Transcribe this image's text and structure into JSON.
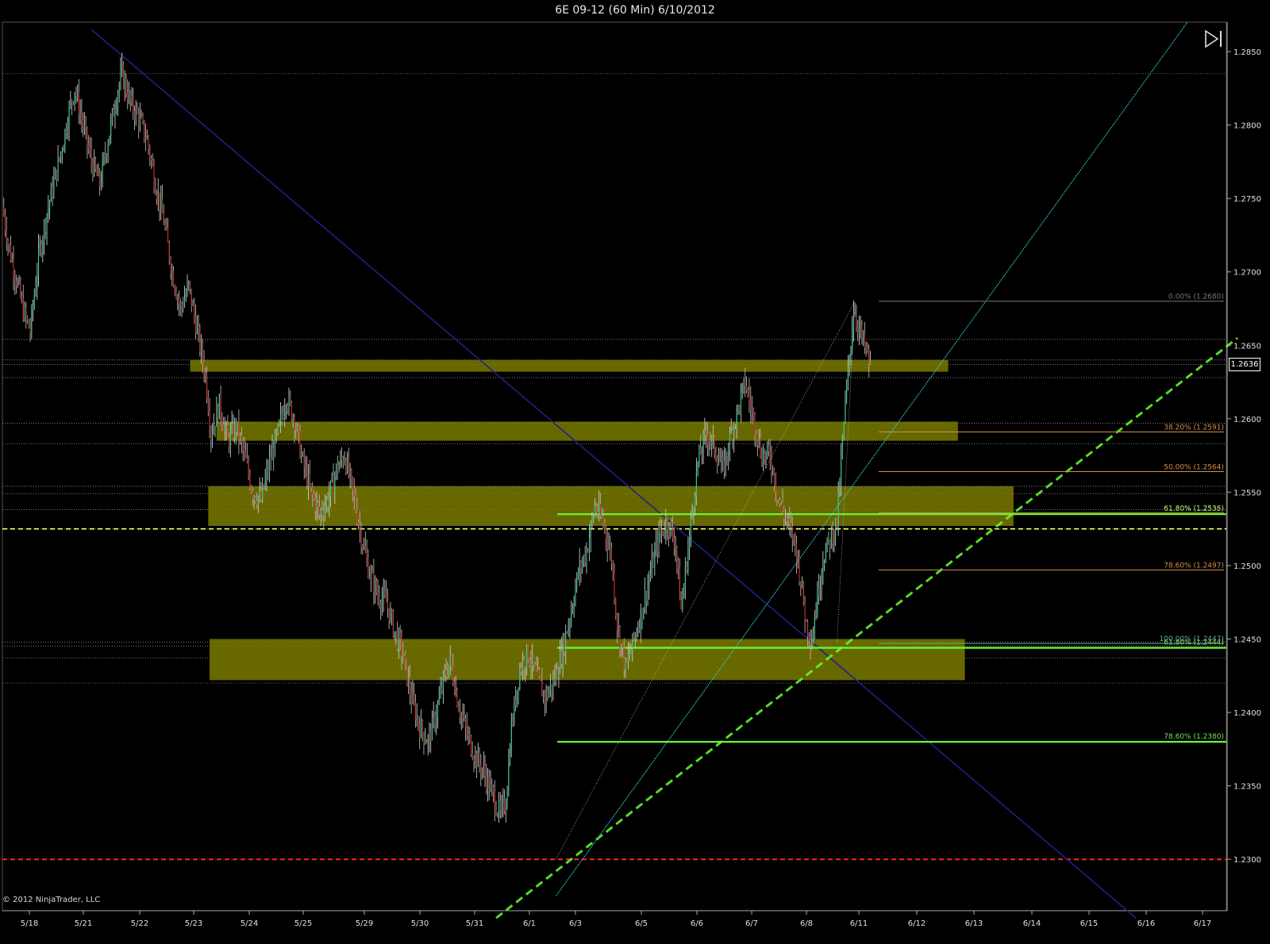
{
  "window": {
    "title": "6E 09-12 (60 Min)  6/10/2012"
  },
  "footer": {
    "copyright": "© 2012 NinjaTrader, LLC"
  },
  "last_price": "1.2636",
  "icons": {
    "scroll_end": "skip-to-end-icon"
  },
  "colors": {
    "background": "#000000",
    "zone": "#7f7f00",
    "fib_orange": "#d09048",
    "fib_green": "#66ff33",
    "support_red": "#ff2020",
    "dashed_yellow": "#ffff66",
    "trend_blue": "#202088",
    "trend_cyan": "#33cccc",
    "up_bar": "#33cc99",
    "down_bar": "#cc3333"
  },
  "chart_data": {
    "type": "candlestick",
    "instrument": "6E 09-12",
    "interval": "60 Min",
    "date": "6/10/2012",
    "y_axis": {
      "range": [
        1.2265,
        1.287
      ],
      "ticks": [
        "1.2850",
        "1.2800",
        "1.2750",
        "1.2700",
        "1.2650",
        "1.2600",
        "1.2550",
        "1.2500",
        "1.2450",
        "1.2400",
        "1.2350",
        "1.2300"
      ]
    },
    "x_axis": {
      "labels": [
        "5/18",
        "5/21",
        "5/22",
        "5/23",
        "5/24",
        "5/25",
        "5/29",
        "5/30",
        "5/31",
        "6/1",
        "6/3",
        "6/5",
        "6/6",
        "6/7",
        "6/8",
        "6/11",
        "6/12",
        "6/13",
        "6/14",
        "6/15",
        "6/16",
        "6/17"
      ]
    },
    "price_path": [
      [
        0,
        1.2745
      ],
      [
        4,
        1.272
      ],
      [
        10,
        1.2695
      ],
      [
        16,
        1.267
      ],
      [
        20,
        1.266
      ],
      [
        26,
        1.271
      ],
      [
        32,
        1.274
      ],
      [
        38,
        1.2765
      ],
      [
        44,
        1.279
      ],
      [
        48,
        1.281
      ],
      [
        52,
        1.2825
      ],
      [
        58,
        1.28
      ],
      [
        64,
        1.2775
      ],
      [
        70,
        1.276
      ],
      [
        76,
        1.279
      ],
      [
        82,
        1.282
      ],
      [
        86,
        1.2835
      ],
      [
        92,
        1.2815
      ],
      [
        98,
        1.2805
      ],
      [
        104,
        1.279
      ],
      [
        110,
        1.276
      ],
      [
        116,
        1.2735
      ],
      [
        122,
        1.27
      ],
      [
        128,
        1.2675
      ],
      [
        134,
        1.269
      ],
      [
        140,
        1.266
      ],
      [
        146,
        1.263
      ],
      [
        150,
        1.259
      ],
      [
        156,
        1.261
      ],
      [
        162,
        1.2585
      ],
      [
        168,
        1.2595
      ],
      [
        174,
        1.2575
      ],
      [
        180,
        1.255
      ],
      [
        186,
        1.2545
      ],
      [
        192,
        1.257
      ],
      [
        198,
        1.259
      ],
      [
        204,
        1.2615
      ],
      [
        210,
        1.26
      ],
      [
        216,
        1.257
      ],
      [
        222,
        1.255
      ],
      [
        228,
        1.2535
      ],
      [
        234,
        1.2545
      ],
      [
        240,
        1.2565
      ],
      [
        246,
        1.2575
      ],
      [
        252,
        1.255
      ],
      [
        258,
        1.252
      ],
      [
        264,
        1.2495
      ],
      [
        270,
        1.248
      ],
      [
        276,
        1.2475
      ],
      [
        282,
        1.2455
      ],
      [
        288,
        1.244
      ],
      [
        294,
        1.241
      ],
      [
        300,
        1.239
      ],
      [
        306,
        1.238
      ],
      [
        312,
        1.24
      ],
      [
        318,
        1.2425
      ],
      [
        322,
        1.2435
      ],
      [
        328,
        1.2405
      ],
      [
        334,
        1.2385
      ],
      [
        340,
        1.237
      ],
      [
        346,
        1.236
      ],
      [
        352,
        1.2345
      ],
      [
        358,
        1.233
      ],
      [
        362,
        1.234
      ],
      [
        366,
        1.239
      ],
      [
        372,
        1.243
      ],
      [
        378,
        1.244
      ],
      [
        384,
        1.2425
      ],
      [
        390,
        1.241
      ],
      [
        396,
        1.242
      ],
      [
        402,
        1.244
      ],
      [
        408,
        1.2465
      ],
      [
        414,
        1.2495
      ],
      [
        420,
        1.251
      ],
      [
        426,
        1.254
      ],
      [
        432,
        1.253
      ],
      [
        438,
        1.2505
      ],
      [
        442,
        1.246
      ],
      [
        448,
        1.243
      ],
      [
        454,
        1.245
      ],
      [
        460,
        1.247
      ],
      [
        466,
        1.2495
      ],
      [
        472,
        1.252
      ],
      [
        478,
        1.253
      ],
      [
        484,
        1.2515
      ],
      [
        488,
        1.247
      ],
      [
        494,
        1.252
      ],
      [
        500,
        1.257
      ],
      [
        506,
        1.259
      ],
      [
        512,
        1.258
      ],
      [
        518,
        1.2565
      ],
      [
        524,
        1.259
      ],
      [
        530,
        1.261
      ],
      [
        534,
        1.2625
      ],
      [
        540,
        1.26
      ],
      [
        546,
        1.2575
      ],
      [
        552,
        1.2575
      ],
      [
        558,
        1.2545
      ],
      [
        564,
        1.253
      ],
      [
        570,
        1.2515
      ],
      [
        574,
        1.249
      ],
      [
        578,
        1.246
      ],
      [
        582,
        1.245
      ],
      [
        586,
        1.248
      ],
      [
        590,
        1.2505
      ],
      [
        596,
        1.252
      ],
      [
        600,
        1.253
      ],
      [
        606,
        1.261
      ],
      [
        612,
        1.2675
      ],
      [
        618,
        1.2655
      ],
      [
        624,
        1.2636
      ]
    ],
    "zones": [
      {
        "top": 1.264,
        "bottom": 1.2632,
        "from": 135,
        "to": 680
      },
      {
        "top": 1.2598,
        "bottom": 1.2585,
        "from": 154,
        "to": 687
      },
      {
        "top": 1.2554,
        "bottom": 1.2527,
        "from": 148,
        "to": 727
      },
      {
        "top": 1.245,
        "bottom": 1.2422,
        "from": 149,
        "to": 692
      }
    ],
    "horizontal_levels": [
      1.2835,
      1.2654,
      1.264,
      1.2637,
      1.2628,
      1.2597,
      1.2583,
      1.2554,
      1.2549,
      1.2538,
      1.2525,
      1.2448,
      1.2445,
      1.2437,
      1.242
    ],
    "fib_retracement_1": {
      "from_idx": 600,
      "labels": [
        "0.00% (1.2680)",
        "38.20% (1.2591)",
        "50.00% (1.2564)",
        "61.80% (1.2536)",
        "78.60% (1.2497)",
        "100.00% (1.2447)"
      ],
      "values": [
        1.268,
        1.2591,
        1.2564,
        1.2536,
        1.2497,
        1.2447
      ]
    },
    "fib_retracement_2": {
      "from_idx": 399,
      "labels": [
        "61.80% (1.2535)",
        "61.80% (1.2444)",
        "78.60% (1.2380)"
      ],
      "values": [
        1.2535,
        1.2444,
        1.238
      ]
    },
    "support_line": 1.23,
    "dashed_level": 1.2525,
    "trendlines": [
      {
        "name": "downtrend",
        "style": "solid",
        "color": "blue",
        "p1": [
          64,
          1.2865
        ],
        "p2": [
          815,
          1.226
        ]
      },
      {
        "name": "uptrend-green",
        "style": "dashed",
        "color": "green",
        "p1": [
          355,
          1.226
        ],
        "p2": [
          888,
          1.2655
        ]
      },
      {
        "name": "uptrend-cyan",
        "style": "dotted",
        "color": "cyan",
        "p1": [
          398,
          1.2275
        ],
        "p2": [
          852,
          1.287
        ]
      },
      {
        "name": "fib-anchor",
        "style": "dotted",
        "color": "white",
        "p1": [
          398,
          1.23
        ],
        "p2": [
          613,
          1.268
        ]
      },
      {
        "name": "fib-swing",
        "style": "dotted",
        "color": "white",
        "p1": [
          600,
          1.2447
        ],
        "p2": [
          613,
          1.268
        ]
      }
    ]
  }
}
